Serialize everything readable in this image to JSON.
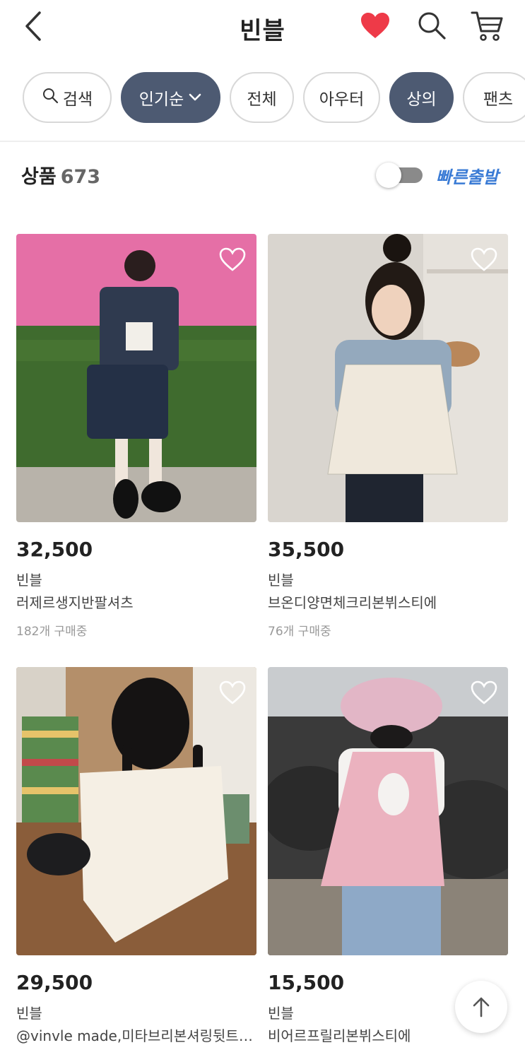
{
  "header": {
    "title": "빈블",
    "icons": [
      "back-icon",
      "heart-icon",
      "search-icon",
      "cart-icon"
    ],
    "heart_color": "#ee3a48"
  },
  "filters": [
    {
      "label": "검색",
      "icon": "search-icon",
      "active": false
    },
    {
      "label": "인기순",
      "icon": "chevron-down-icon",
      "active": true
    },
    {
      "label": "전체",
      "active": false
    },
    {
      "label": "아우터",
      "active": false
    },
    {
      "label": "상의",
      "active": true
    },
    {
      "label": "팬츠",
      "active": false
    }
  ],
  "summary": {
    "label": "상품",
    "count": "673",
    "fast_shipping_label": "빠른출발",
    "fast_shipping_on": false
  },
  "products": [
    {
      "price": "32,500",
      "brand": "빈블",
      "name": "러제르생지반팔셔츠",
      "buyers": "182개 구매중"
    },
    {
      "price": "35,500",
      "brand": "빈블",
      "name": "브온디양면체크리본뷔스티에",
      "buyers": "76개 구매중"
    },
    {
      "price": "29,500",
      "brand": "빈블",
      "name": "@vinvle made,미타브리본셔링뒷트임블라우스",
      "buyers": ""
    },
    {
      "price": "15,500",
      "brand": "빈블",
      "name": "비어르프릴리본뷔스티에",
      "buyers": ""
    }
  ],
  "colors": {
    "accent": "#4d5a72",
    "fast_shipping": "#3a7bd5"
  }
}
